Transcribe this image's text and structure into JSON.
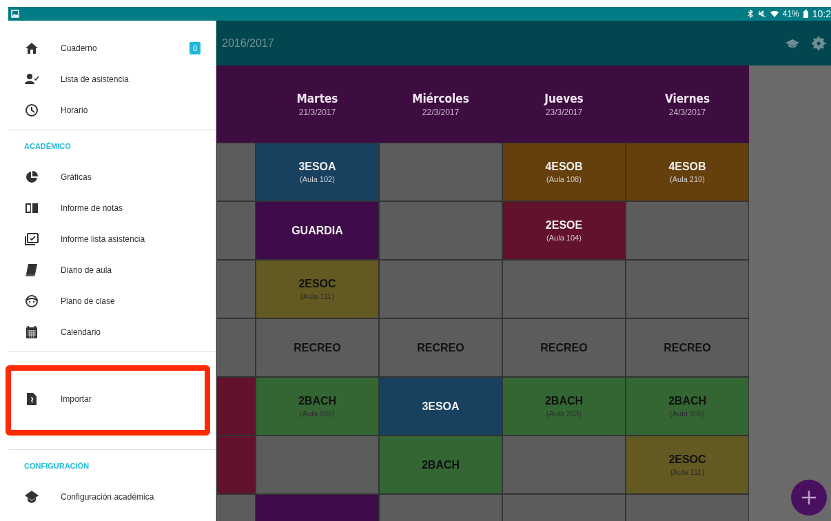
{
  "status_bar": {
    "battery": "41%",
    "time": "10:2"
  },
  "drawer": {
    "sections": [
      {
        "items": [
          {
            "label": "Cuaderno",
            "kind": "home",
            "badge": "0"
          },
          {
            "label": "Lista de asistencia",
            "kind": "attendance"
          },
          {
            "label": "Horario",
            "kind": "schedule"
          }
        ]
      },
      {
        "header": "ACADÉMICO",
        "items": [
          {
            "label": "Gráficas",
            "kind": "charts"
          },
          {
            "label": "Informe de notas",
            "kind": "grades"
          },
          {
            "label": "Informe lista asistencia",
            "kind": "report"
          },
          {
            "label": "Diario de aula",
            "kind": "diary"
          },
          {
            "label": "Plano de clase",
            "kind": "seating"
          },
          {
            "label": "Calendario",
            "kind": "calendar"
          }
        ]
      },
      {
        "items": [
          {
            "label": "Importar",
            "kind": "import"
          }
        ]
      },
      {
        "header": "CONFIGURACIÓN",
        "items": [
          {
            "label": "Configuración académica",
            "kind": "settings"
          }
        ]
      }
    ]
  },
  "app_bar": {
    "title": "2016/2017"
  },
  "timetable": {
    "days": [
      {
        "name": "Martes",
        "date": "21/3/2017"
      },
      {
        "name": "Miércoles",
        "date": "22/3/2017"
      },
      {
        "name": "Jueves",
        "date": "23/3/2017"
      },
      {
        "name": "Viernes",
        "date": "24/3/2017"
      }
    ],
    "rows": [
      [
        {
          "color": "#5c5c5c"
        },
        {
          "title": "3ESOA",
          "room": "(Aula 102)",
          "color": "#17415f"
        },
        {
          "color": "#5c5c5c"
        },
        {
          "title": "4ESOB",
          "room": "(Aula 108)",
          "color": "#65400c"
        },
        {
          "title": "4ESOB",
          "room": "(Aula 210)",
          "color": "#65400c"
        }
      ],
      [
        {
          "color": "#5c5c5c"
        },
        {
          "title": "GUARDIA",
          "color": "#3f0b4a"
        },
        {
          "color": "#5c5c5c"
        },
        {
          "title": "2ESOE",
          "room": "(Aula 104)",
          "color": "#62122b"
        },
        {
          "color": "#5c5c5c"
        }
      ],
      [
        {
          "color": "#5c5c5c"
        },
        {
          "title": "2ESOC",
          "room": "(Aula 111)",
          "color": "#625a22"
        },
        {
          "color": "#5c5c5c"
        },
        {
          "color": "#5c5c5c"
        },
        {
          "color": "#5c5c5c"
        }
      ],
      [
        {
          "color": "#5c5c5c"
        },
        {
          "title": "RECREO",
          "color": "#5c5c5c"
        },
        {
          "title": "RECREO",
          "color": "#5c5c5c"
        },
        {
          "title": "RECREO",
          "color": "#5c5c5c"
        },
        {
          "title": "RECREO",
          "color": "#5c5c5c"
        }
      ],
      [
        {
          "color": "#62122b"
        },
        {
          "title": "2BACH",
          "room": "(Aula 006)",
          "color": "#346634"
        },
        {
          "title": "3ESOA",
          "color": "#17415f"
        },
        {
          "title": "2BACH",
          "room": "(Aula 203)",
          "color": "#346634"
        },
        {
          "title": "2BACH",
          "room": "(Aula 006)",
          "color": "#346634"
        }
      ],
      [
        {
          "color": "#62122b"
        },
        {
          "color": "#5c5c5c"
        },
        {
          "title": "2BACH",
          "color": "#346634"
        },
        {
          "color": "#5c5c5c"
        },
        {
          "title": "2ESOC",
          "room": "(Aula 111)",
          "color": "#625a22"
        }
      ],
      [
        {
          "color": "#5c5c5c"
        },
        {
          "color": "#3f0b4a"
        },
        {
          "color": "#5c5c5c"
        },
        {
          "color": "#5c5c5c"
        },
        {
          "color": "#5c5c5c"
        }
      ]
    ]
  },
  "highlight_frame": true
}
